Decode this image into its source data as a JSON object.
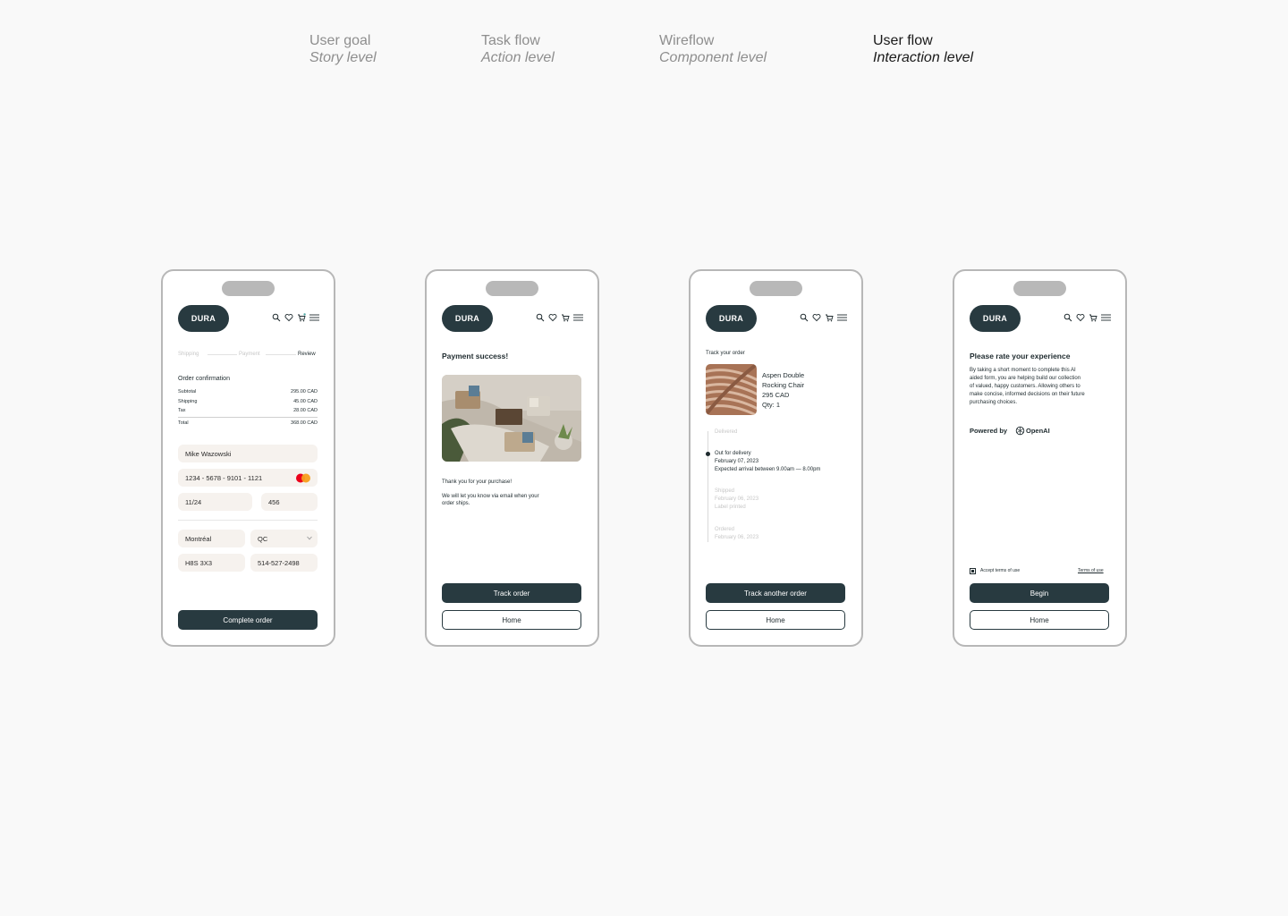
{
  "tabs": [
    {
      "title": "User goal",
      "subtitle": "Story level"
    },
    {
      "title": "Task flow",
      "subtitle": "Action level"
    },
    {
      "title": "Wireflow",
      "subtitle": "Component level"
    },
    {
      "title": "User flow",
      "subtitle": "Interaction level"
    }
  ],
  "brand": "DURA",
  "phone1": {
    "steps": [
      "Shipping",
      "Payment",
      "Review"
    ],
    "section_title": "Order confirmation",
    "summary": [
      {
        "label": "Subtotal",
        "value": "295.00 CAD"
      },
      {
        "label": "Shipping",
        "value": "45.00 CAD"
      },
      {
        "label": "Tax",
        "value": "28.00 CAD"
      },
      {
        "label": "Total",
        "value": "368.00 CAD"
      }
    ],
    "name": "Mike Wazowski",
    "card_number": "1234 - 5678 - 9101 - 1121",
    "expiry": "11/24",
    "cvv": "456",
    "city": "Montréal",
    "province": "QC",
    "postal": "H8S 3X3",
    "phone": "514-527-2498",
    "cta": "Complete order"
  },
  "phone2": {
    "title": "Payment success!",
    "thanks": "Thank you for your purchase!",
    "message_line1": "We will let you know via email when your",
    "message_line2": "order ships.",
    "primary": "Track order",
    "secondary": "Home"
  },
  "phone3": {
    "title": "Track your order",
    "product_line1": "Aspen Double",
    "product_line2": "Rocking Chair",
    "price": "295 CAD",
    "qty": "Qty: 1",
    "timeline": {
      "delivered": "Delivered",
      "out_title": "Out for delivery",
      "out_date": "February 07, 2023",
      "out_note": "Expected arrival between 9.00am — 8.00pm",
      "shipped_title": "Shipped",
      "shipped_date": "February 06, 2023",
      "shipped_note": "Label printed",
      "ordered_title": "Ordered",
      "ordered_date": "February 06, 2023"
    },
    "primary": "Track another order",
    "secondary": "Home"
  },
  "phone4": {
    "title": "Please rate your experience",
    "body": [
      "By taking a short moment to complete this AI",
      "aided form, you are helping build our collection",
      "of valued, happy customers. Allowing others to",
      "make concise, informed decisions on their future",
      "purchasing choices."
    ],
    "powered_by": "Powered by",
    "provider": "OpenAI",
    "accept_terms": "Accept terms of use",
    "terms_link": "Terms of use",
    "primary": "Begin",
    "secondary": "Home"
  },
  "colors": {
    "brand_dark": "#283a40",
    "field_bg": "#f6f2ee",
    "page_bg": "#f9f9f9",
    "frame": "#b7b7b7"
  }
}
